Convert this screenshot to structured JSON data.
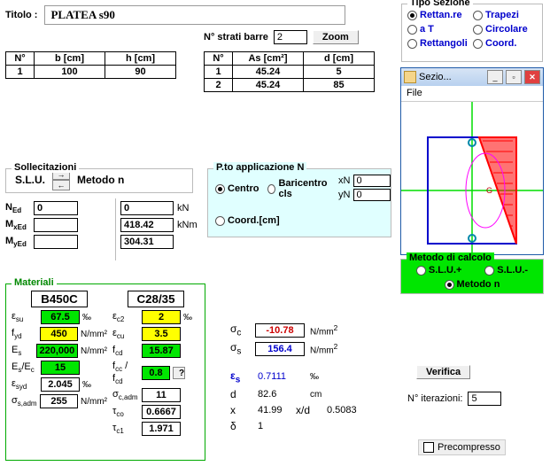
{
  "title_label": "Titolo :",
  "title_value": "PLATEA s90",
  "strati": {
    "label": "N° strati barre",
    "value": "2",
    "zoom": "Zoom"
  },
  "tipo": {
    "legend": "Tipo Sezione",
    "opts": [
      "Rettan.re",
      "Trapezi",
      "a T",
      "Circolare",
      "Rettangoli",
      "Coord."
    ],
    "selected": 0
  },
  "table1": {
    "headers": [
      "N°",
      "b [cm]",
      "h [cm]"
    ],
    "rows": [
      [
        "1",
        "100",
        "90"
      ]
    ]
  },
  "table2": {
    "headers": [
      "N°",
      "As [cm²]",
      "d [cm]"
    ],
    "rows": [
      [
        "1",
        "45.24",
        "5"
      ],
      [
        "2",
        "45.24",
        "85"
      ]
    ]
  },
  "soll": {
    "legend": "Sollecitazioni",
    "slu": "S.L.U.",
    "metodo": "Metodo n"
  },
  "forces": {
    "NEd_lbl": "N",
    "NEd_sub": "Ed",
    "NEd": "0",
    "NEd2": "0",
    "kN": "kN",
    "MxEd_lbl": "M",
    "MxEd_sub": "xEd",
    "MxEd": "",
    "MxEd2": "418.42",
    "kNm": "kNm",
    "MyEd_lbl": "M",
    "MyEd_sub": "yEd",
    "MyEd": "",
    "MyEd2": "304.31"
  },
  "papp": {
    "legend": "P.to applicazione N",
    "centro": "Centro",
    "bar": "Baricentro cls",
    "coord": "Coord.[cm]",
    "xN_lbl": "xN",
    "yN_lbl": "yN",
    "xN": "0",
    "yN": "0"
  },
  "window": {
    "title": "Sezio...",
    "menu": "File"
  },
  "metodo": {
    "legend": "Metodo di calcolo",
    "opts": [
      "S.L.U.+",
      "S.L.U.-",
      "Metodo n"
    ],
    "selected": 2
  },
  "mat": {
    "legend": "Materiali",
    "steel": "B450C",
    "conc": "C28/35",
    "e_su_l": "ε",
    "e_su_s": "su",
    "e_su": "67.5",
    "permille": "‰",
    "e_c2_l": "ε",
    "e_c2_s": "c2",
    "e_c2": "2",
    "fyd_l": "f",
    "fyd_s": "yd",
    "fyd": "450",
    "nmm2": "N/mm²",
    "ecu_l": "ε",
    "ecu_s": "cu",
    "ecu": "3.5",
    "Es_l": "E",
    "Es_s": "s",
    "Es": "220,000",
    "fcd_l": "f",
    "fcd_s": "cd",
    "fcd": "15.87",
    "EsEc_l": "E",
    "EsEc_s": "s",
    "EsEc_s2": "/E",
    "EsEc_s3": "c",
    "EsEc": "15",
    "fccfcd_l": "f",
    "fccfcd_s": "cc",
    "fccfcd_s2": " / f",
    "fccfcd_s3": "cd",
    "fccfcd": "0.8",
    "q": "?",
    "esyd_l": "ε",
    "esyd_s": "syd",
    "esyd": "2.045",
    "sigcadm_l": "σ",
    "sigcadm_s": "c,adm",
    "sigcadm": "11",
    "sigsadm_l": "σ",
    "sigsadm_s": "s,adm",
    "sigsadm": "255",
    "tco_l": "τ",
    "tco_s": "co",
    "tco": "0.6667",
    "tc1_l": "τ",
    "tc1_s": "c1",
    "tc1": "1.971"
  },
  "res": {
    "sigc_l": "σ",
    "sigc_s": "c",
    "sigc": "-10.78",
    "nmm2": "N/mm",
    "sigs_l": "σ",
    "sigs_s": "s",
    "sigs": "156.4",
    "eps_l": "ε",
    "eps_s": "s",
    "eps": "0.7111",
    "permille": "‰",
    "d_l": "d",
    "d": "82.6",
    "cm": "cm",
    "x_l": "x",
    "x": "41.99",
    "xd_l": "x/d",
    "xd": "0.5083",
    "delta_l": "δ",
    "delta": "1"
  },
  "verifica": "Verifica",
  "iter_lbl": "N° iterazioni:",
  "iter": "5",
  "precomp": "Precompresso"
}
